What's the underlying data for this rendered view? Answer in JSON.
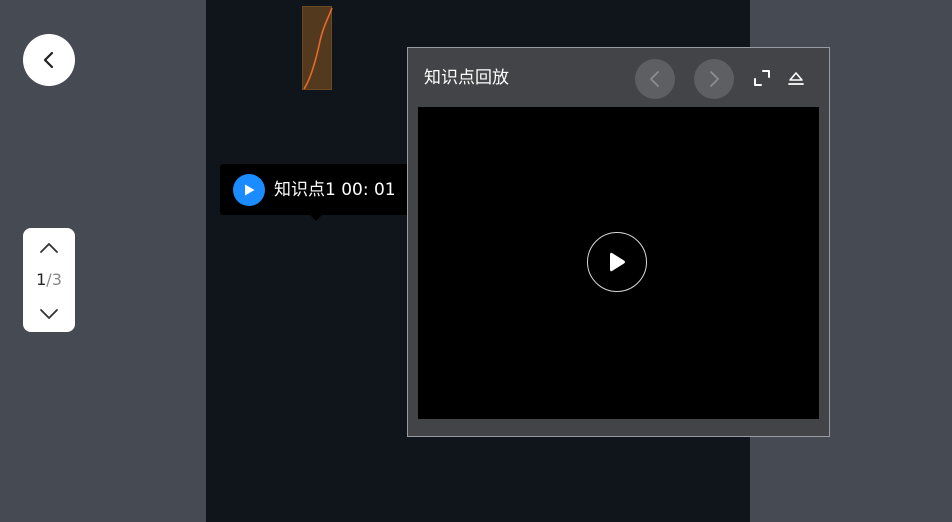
{
  "pager": {
    "current": "1",
    "separator": "/",
    "total": "3"
  },
  "knowledge_point": {
    "label": "知识点1 00: 01"
  },
  "playback_panel": {
    "title": "知识点回放"
  },
  "colors": {
    "chip_play": "#1a8cff",
    "thumb_line": "#e86a2a",
    "page_background": "#10151c",
    "panel_background": "#434447"
  },
  "icons": {
    "back": "chevron-left-icon",
    "page_up": "chevron-up-icon",
    "page_down": "chevron-down-icon",
    "chip_play": "play-icon",
    "panel_prev": "chevron-left-icon",
    "panel_next": "chevron-right-icon",
    "expand": "expand-icon",
    "collapse": "collapse-icon",
    "video_play": "play-icon"
  }
}
